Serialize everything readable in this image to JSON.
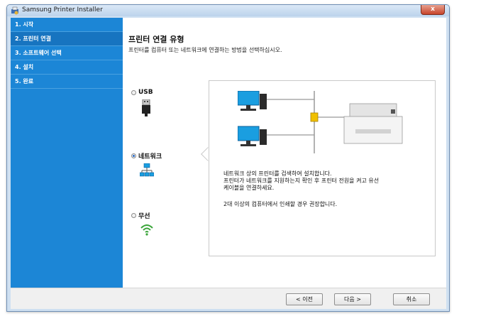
{
  "window": {
    "title": "Samsung Printer Installer",
    "close_label": "x"
  },
  "sidebar": {
    "items": [
      {
        "label": "1. 시작",
        "active": false
      },
      {
        "label": "2. 프린터 연결",
        "active": true
      },
      {
        "label": "3. 소프트웨어 선택",
        "active": false
      },
      {
        "label": "4. 설치",
        "active": false
      },
      {
        "label": "5. 완료",
        "active": false
      }
    ]
  },
  "main": {
    "title": "프린터 연결 유형",
    "subtitle": "프린터를 컴퓨터 또는 네트워크에 연결하는 방법을 선택하십시오.",
    "options": [
      {
        "label": "USB",
        "icon": "usb-icon",
        "selected": false
      },
      {
        "label": "네트워크",
        "icon": "network-icon",
        "selected": true
      },
      {
        "label": "무선",
        "icon": "wifi-icon",
        "selected": false
      }
    ],
    "description": {
      "line1": "네트워크 상의 프린터를 검색하여 설치합니다.",
      "line2": "프린터가 네트워크를 지원하는지 확인 후 프린터 전원을 켜고 유선",
      "line3": "케이블을 연결하세요.",
      "line4": "2대 이상의 컴퓨터에서 인쇄할 경우 권장합니다."
    }
  },
  "footer": {
    "back_label": "< 이전",
    "next_label": "다음 >",
    "cancel_label": "취소"
  },
  "colors": {
    "sidebar": "#1c86d6",
    "sidebar_active": "#1774c0",
    "monitor": "#1a9ee0",
    "hub": "#f0c000",
    "wifi": "#3aa53a"
  }
}
